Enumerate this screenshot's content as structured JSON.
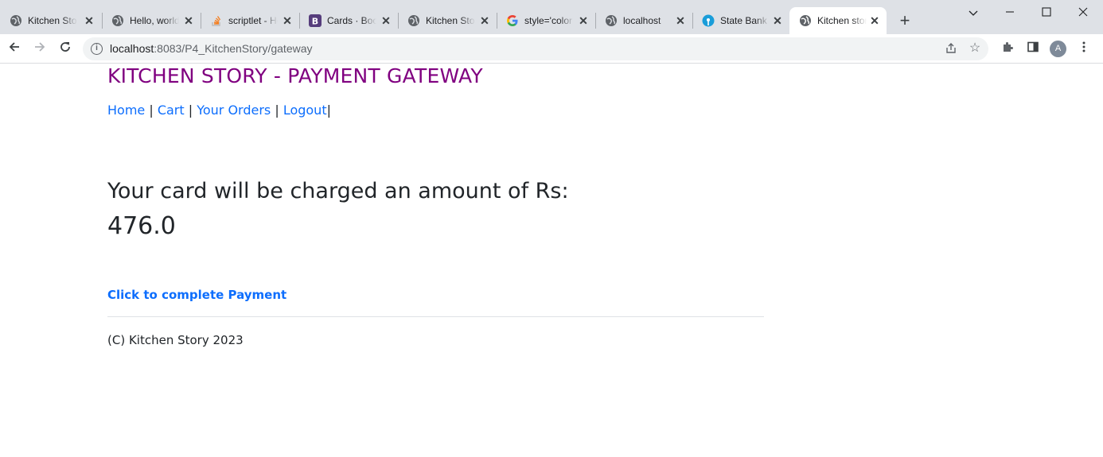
{
  "browser": {
    "tabs": [
      {
        "title": "Kitchen Story",
        "icon": "globe-icon"
      },
      {
        "title": "Hello, world!",
        "icon": "globe-icon"
      },
      {
        "title": "scriptlet - How",
        "icon": "stackoverflow-icon"
      },
      {
        "title": "Cards · Bootstrap",
        "icon": "bootstrap-icon"
      },
      {
        "title": "Kitchen Story",
        "icon": "globe-icon"
      },
      {
        "title": "style='color",
        "icon": "google-icon"
      },
      {
        "title": "localhost",
        "icon": "globe-icon"
      },
      {
        "title": "State Bank",
        "icon": "sbi-icon"
      },
      {
        "title": "Kitchen story",
        "icon": "globe-icon",
        "active": true
      }
    ],
    "new_tab_label": "+",
    "url_host": "localhost",
    "url_path": ":8083/P4_KitchenStory/gateway",
    "profile_initial": "A"
  },
  "page": {
    "heading": "KITCHEN STORY - PAYMENT GATEWAY",
    "nav": {
      "home": "Home",
      "cart": "Cart",
      "orders": "Your Orders",
      "logout": "Logout",
      "separator": " | ",
      "trailing": "|"
    },
    "charge_text": "Your card will be charged an amount of Rs:",
    "amount": "476.0",
    "pay_link": "Click to complete Payment",
    "footer": "(C) Kitchen Story 2023"
  },
  "colors": {
    "heading": "#800080",
    "link": "#0d6efd",
    "text": "#212529"
  }
}
